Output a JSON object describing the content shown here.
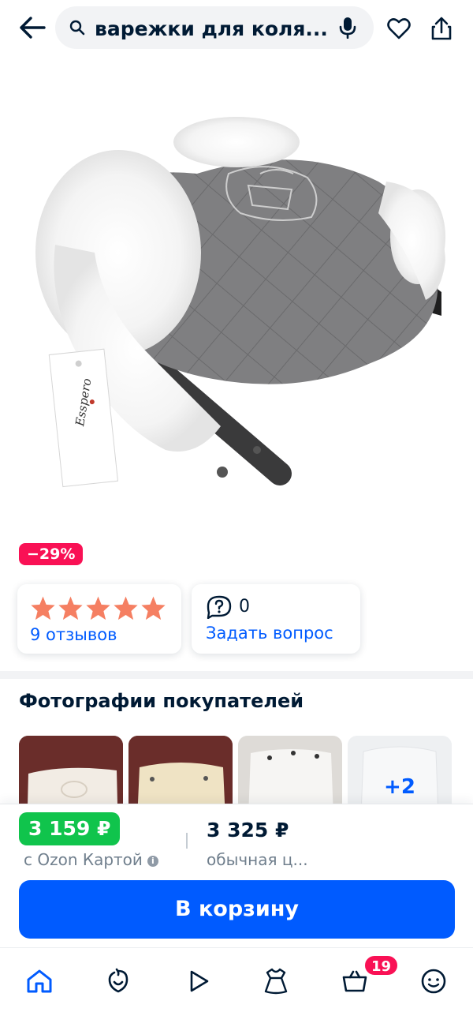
{
  "header": {
    "search_query": "варежки для коля..."
  },
  "product": {
    "discount_badge": "−29%",
    "rating_stars": 5,
    "reviews_link": "9 отзывов",
    "questions_count": "0",
    "ask_question_link": "Задать вопрос",
    "tag_brand": "Esspero"
  },
  "customer_photos": {
    "title": "Фотографии покупателей",
    "more_label": "+2"
  },
  "price": {
    "ozon_card_price": "3 159 ₽",
    "ozon_card_label": "с Ozon Картой",
    "regular_price": "3 325 ₽",
    "regular_label": "обычная ц...",
    "add_to_cart": "В корзину"
  },
  "bottom_nav": {
    "cart_count": "19"
  },
  "colors": {
    "accent": "#005bff",
    "discount": "#f91155",
    "ozon_price": "#10c44c",
    "star": "#f57f62"
  }
}
